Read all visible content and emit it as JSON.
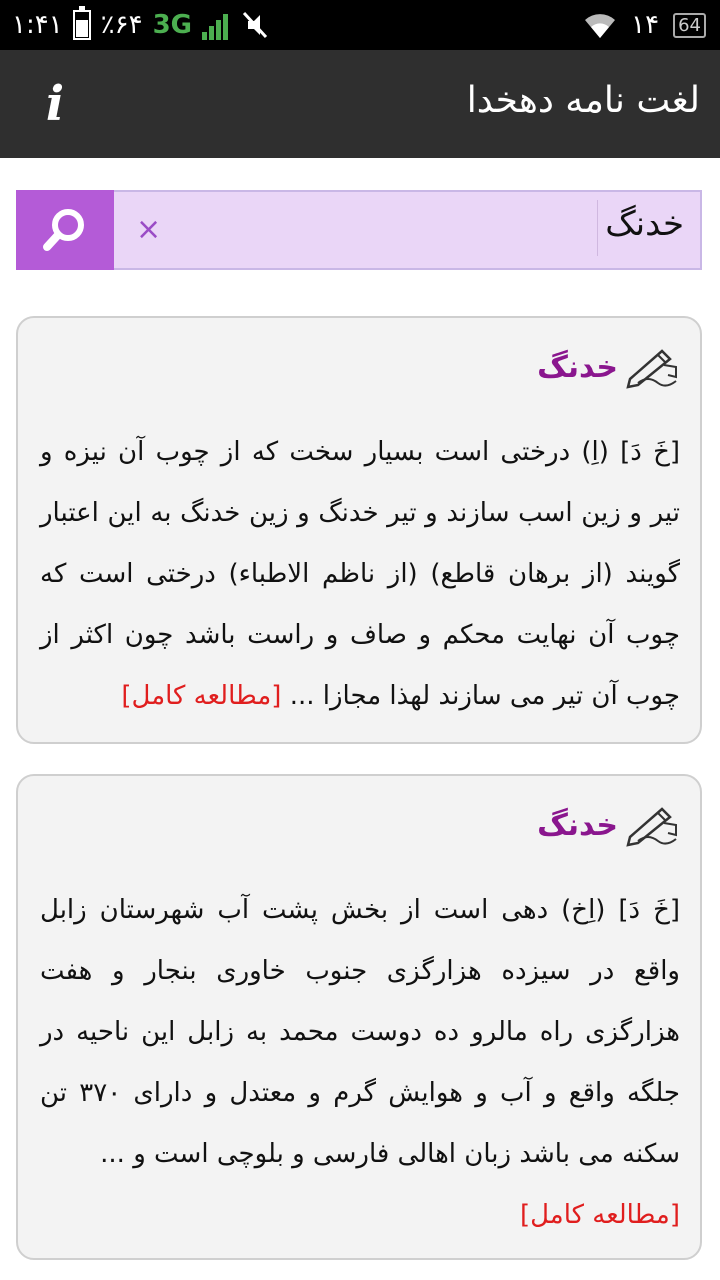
{
  "status_bar": {
    "time": "۱:۴۱",
    "battery_percent": "٪۶۴",
    "network": "3G",
    "right_number": "۱۴",
    "battery_box": "64",
    "icons": [
      "battery-icon",
      "signal-icon",
      "mute-icon",
      "wifi-icon"
    ]
  },
  "app_bar": {
    "title": "لغت نامه دهخدا",
    "info_icon": "i"
  },
  "search": {
    "value": "خدنگ",
    "clear_symbol": "×"
  },
  "results": [
    {
      "title": "خدنگ",
      "body": "[خَ دَ] (اِ) درختی است بسیار سخت که از چوب آن نیزه و تیر و زین اسب سازند و تیر خدنگ و زین خدنگ به این اعتبار گویند (از برهان قاطع) (از ناظم الاطباء) درختی است که چوب آن نهایت محکم و صاف و راست باشد چون اکثر از چوب آن تیر می سازند لهذا مجازا ...",
      "more": "[مطالعه کامل]"
    },
    {
      "title": "خدنگ",
      "body": "[خَ دَ] (اِخ) دهی است از بخش پشت آب شهرستان زابل واقع در سیزده هزارگزی جنوب خاوری بنجار و هفت هزارگزی راه مالرو ده دوست محمد به زابل این ناحیه در جلگه واقع و آب و هوایش گرم و معتدل و دارای ۳۷۰ تن سکنه می باشد زبان اهالی فارسی و بلوچی است و ...",
      "more": "[مطالعه کامل]"
    }
  ],
  "colors": {
    "app_bar": "#2f2f2f",
    "search_bg": "#ead6f7",
    "search_button": "#b45bd7",
    "title": "#8a168e",
    "more_link": "#e01e1e"
  }
}
